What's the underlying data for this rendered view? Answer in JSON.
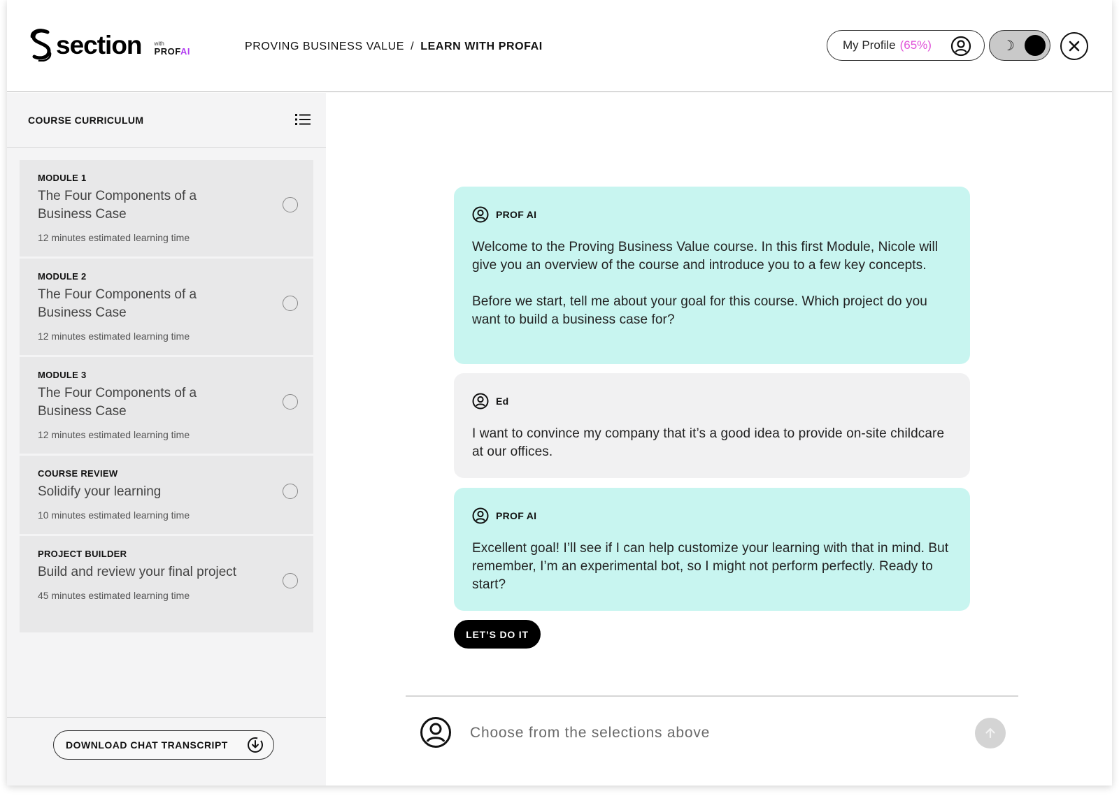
{
  "header": {
    "logo_text": "section",
    "logo_with": "with",
    "logo_prof": "PROF",
    "logo_ai": "AI",
    "breadcrumb": {
      "parent": "PROVING BUSINESS VALUE",
      "separator": "/",
      "current": "LEARN WITH PROFAI"
    },
    "profile": {
      "label": "My Profile",
      "progress": "(65%)",
      "icon": "user-circle-icon"
    },
    "theme_toggle": {
      "icon": "moon-icon",
      "state": "dark"
    },
    "close_icon": "close-icon"
  },
  "sidebar": {
    "title": "COURSE CURRICULUM",
    "list_icon": "list-icon",
    "modules": [
      {
        "label": "MODULE 1",
        "title": "The Four Components of a Business Case",
        "time": "12 minutes estimated learning time"
      },
      {
        "label": "MODULE 2",
        "title": "The Four Components of a Business Case",
        "time": "12 minutes estimated learning time"
      },
      {
        "label": "MODULE 3",
        "title": "The Four Components of a Business Case",
        "time": "12 minutes estimated learning time"
      },
      {
        "label": "COURSE REVIEW",
        "title": "Solidify your learning",
        "time": "10 minutes estimated learning time"
      },
      {
        "label": "PROJECT BUILDER",
        "title": "Build and review your final project",
        "time": "45 minutes estimated learning time"
      }
    ],
    "download_label": "DOWNLOAD CHAT TRANSCRIPT",
    "download_icon": "download-icon"
  },
  "chat": {
    "messages": [
      {
        "author": "PROF AI",
        "text": "Welcome to the Proving Business Value course. In this first Module, Nicole will give you an overview of the course and introduce you to a few key concepts.",
        "text2": "Before we start, tell me about your goal for this course. Which project do you want to build a business case for?"
      },
      {
        "author": "Ed",
        "text": "I want to convince my company that it’s a good idea to provide on-site childcare at our offices."
      },
      {
        "author": "PROF AI",
        "text": "Excellent goal! I’ll see if I can help customize your learning with that in mind. But remember, I’m an experimental bot, so I might not perform perfectly. Ready to start?"
      }
    ],
    "cta_label": "LET’S DO IT",
    "composer": {
      "placeholder": "Choose from the selections above",
      "send_icon": "arrow-up-icon"
    }
  },
  "colors": {
    "ai_bubble": "#c8f5f0",
    "user_bubble": "#f1f1f2",
    "accent": "#e054d8",
    "brand_ai": "#b23ff0"
  }
}
